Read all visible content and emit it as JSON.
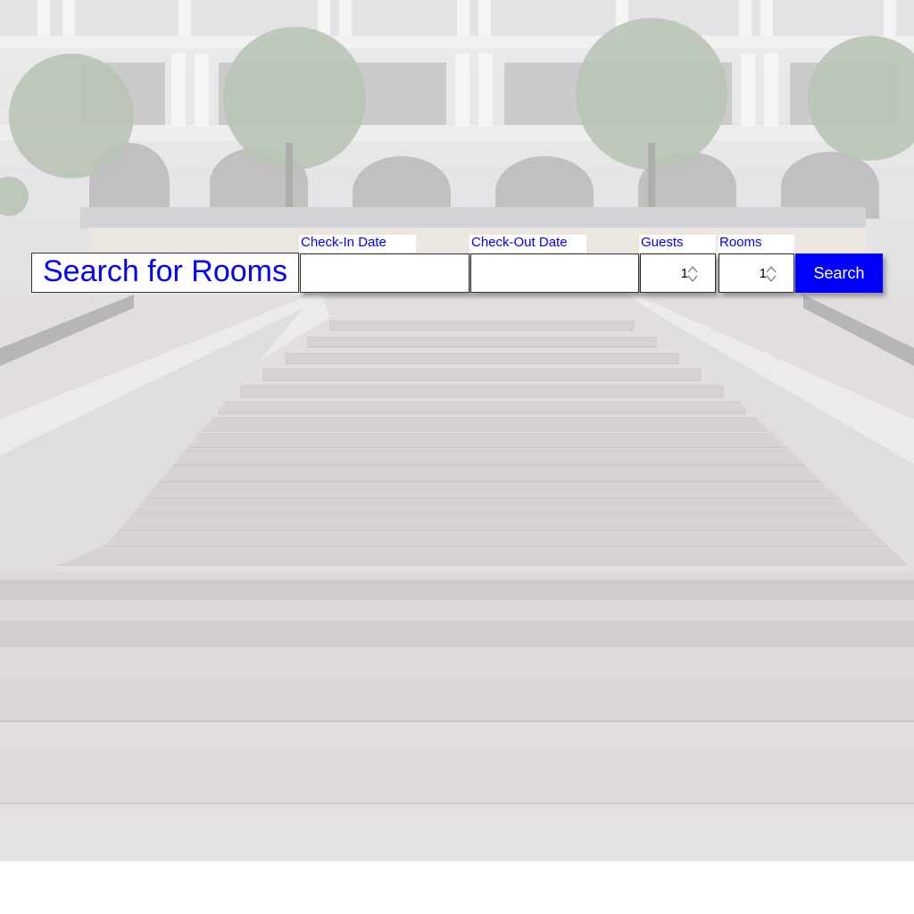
{
  "search": {
    "title": "Search for Rooms",
    "checkin_label": "Check-In Date",
    "checkin_value": "",
    "checkout_label": "Check-Out Date",
    "checkout_value": "",
    "guests_label": "Guests",
    "guests_value": "1",
    "rooms_label": "Rooms",
    "rooms_value": "1",
    "button_label": "Search"
  },
  "colors": {
    "accent": "#0000ff",
    "field_bg": "#ffffff"
  },
  "icons": {
    "stepper": "up-down-arrows-icon"
  }
}
